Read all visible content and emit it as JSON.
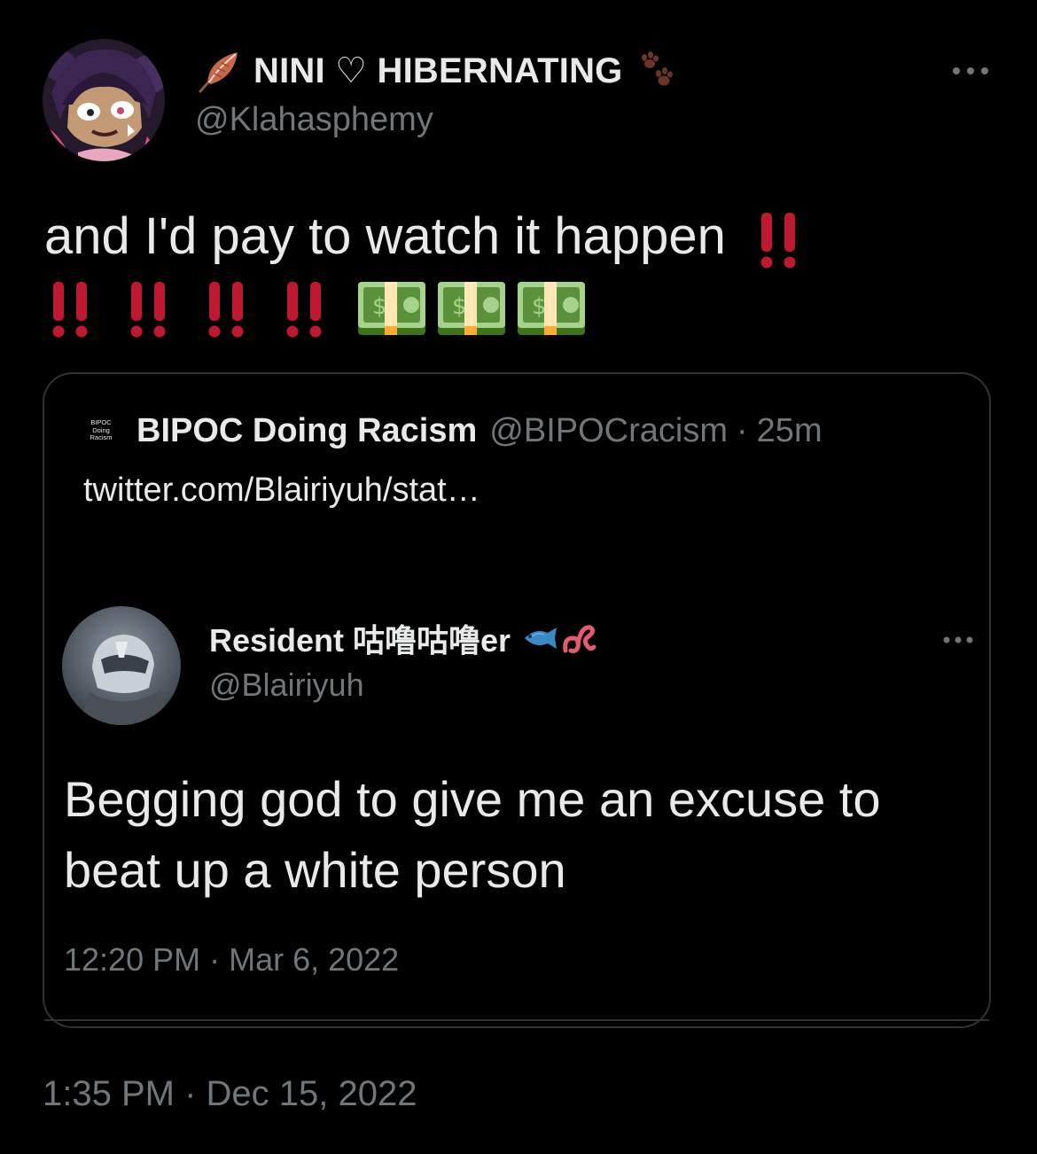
{
  "tweet": {
    "display_name": "NINI ♡ HIBERNATING",
    "handle": "@Klahasphemy",
    "text_line1": "and I'd pay to watch it happen",
    "timestamp": "1:35 PM · Dec 15, 2022",
    "icons": {
      "name_prefix": "feather-icon",
      "name_suffix": "paw-prints-icon",
      "more": "more-icon",
      "emphasis": "double-exclamation-icon",
      "money": "money-banknote-icon"
    },
    "emoji_sequence": [
      "double-exclamation",
      "double-exclamation",
      "double-exclamation",
      "double-exclamation",
      "double-exclamation",
      "money",
      "money",
      "money"
    ]
  },
  "quote": {
    "avatar_text": [
      "BIPOC",
      "Doing",
      "Racism"
    ],
    "name": "BIPOC Doing Racism",
    "handle": "@BIPOCracism",
    "separator": "·",
    "time": "25m",
    "link": "twitter.com/Blairiyuh/stat…",
    "embedded": {
      "name": "Resident 咕噜咕噜er",
      "handle": "@Blairiyuh",
      "text": "Begging god to give me an excuse to beat up a white person",
      "timestamp": "12:20 PM · Mar 6, 2022",
      "icons": {
        "fish": "fish-icon",
        "worm": "worm-icon",
        "more": "more-icon"
      }
    }
  },
  "colors": {
    "background": "#000000",
    "text": "#e7e9ea",
    "secondary": "#71767b",
    "border": "#2f3336",
    "exclamation_red": "#be1931",
    "money_green": "#5c913b"
  }
}
